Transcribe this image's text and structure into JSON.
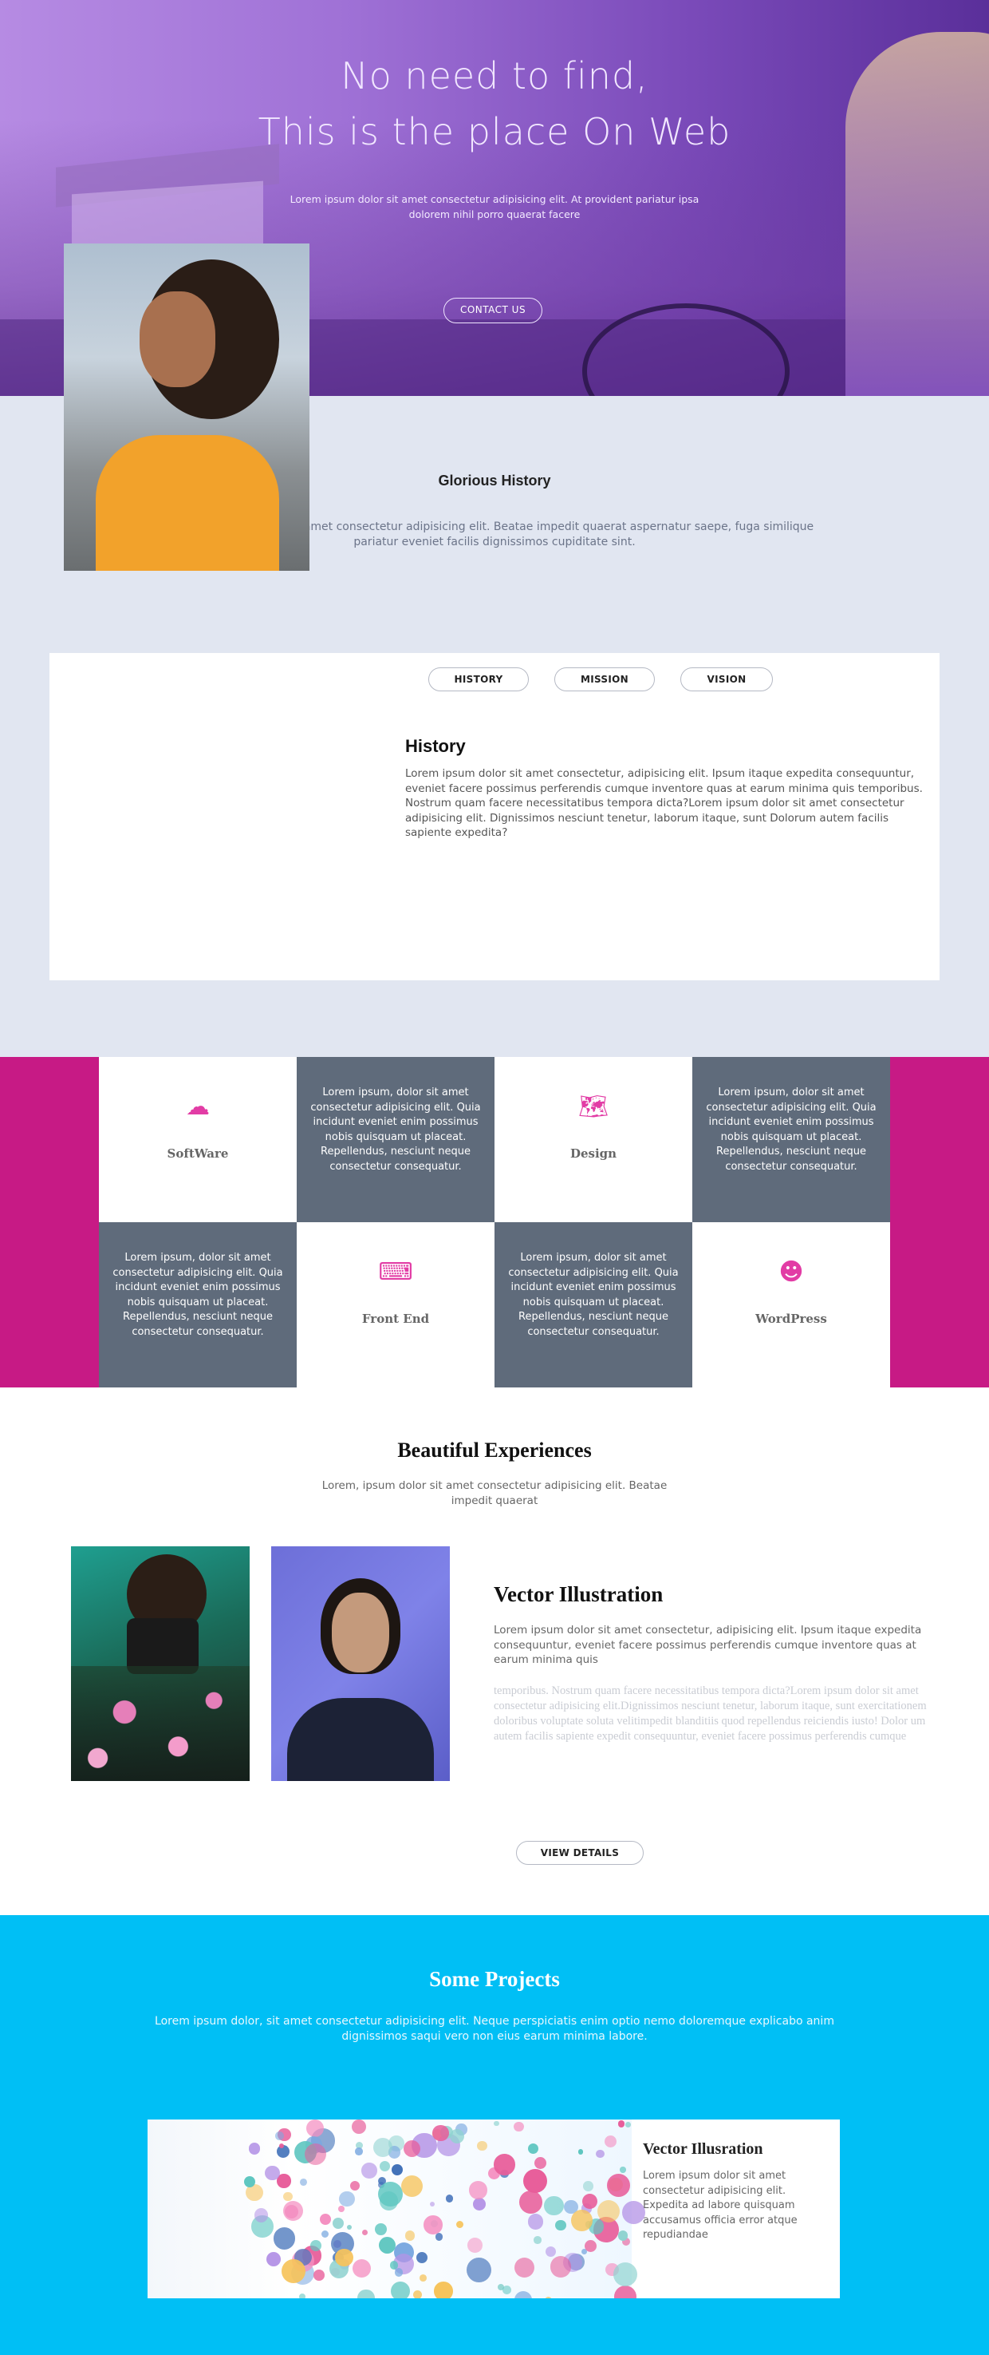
{
  "hero": {
    "title_line1": "No need to find,",
    "title_line2": "This is the place On Web",
    "lead": "Lorem ipsum dolor sit amet consectetur adipisicing elit. At provident pariatur ipsa dolorem nihil porro quaerat facere",
    "cta_label": "CONTACT US"
  },
  "history_section": {
    "title": "Glorious History",
    "description": "Lorem, ipsum dolor sit amet consectetur adipisicing elit. Beatae impedit quaerat aspernatur saepe, fuga similique pariatur eveniet facilis dignissimos cupiditate sint.",
    "tabs": [
      {
        "label": "HISTORY"
      },
      {
        "label": "MISSION"
      },
      {
        "label": "VISION"
      }
    ],
    "heading": "History",
    "body": "Lorem ipsum dolor sit amet consectetur, adipisicing elit. Ipsum itaque expedita consequuntur, eveniet facere possimus perferendis cumque inventore quas at earum minima quis temporibus. Nostrum quam facere necessitatibus tempora dicta?Lorem ipsum dolor sit amet consectetur adipisicing elit. Dignissimos nesciunt tenetur, laborum itaque, sunt Dolorum autem facilis sapiente expedita?"
  },
  "services": {
    "cells": [
      {
        "kind": "feature",
        "label": "SoftWare",
        "icon": "cloud-sun-icon",
        "glyph": "☁"
      },
      {
        "kind": "text",
        "text": "Lorem ipsum, dolor sit amet consectetur adipisicing elit. Quia incidunt eveniet enim possimus nobis quisquam ut placeat. Repellendus, nesciunt neque consectetur consequatur."
      },
      {
        "kind": "feature",
        "label": "Design",
        "icon": "world-map-icon",
        "glyph": "🗺"
      },
      {
        "kind": "text",
        "text": "Lorem ipsum, dolor sit amet consectetur adipisicing elit. Quia incidunt eveniet enim possimus nobis quisquam ut placeat. Repellendus, nesciunt neque consectetur consequatur."
      },
      {
        "kind": "text",
        "text": "Lorem ipsum, dolor sit amet consectetur adipisicing elit. Quia incidunt eveniet enim possimus nobis quisquam ut placeat. Repellendus, nesciunt neque consectetur consequatur."
      },
      {
        "kind": "feature",
        "label": "Front End",
        "icon": "laptop-code-icon",
        "glyph": "⌨"
      },
      {
        "kind": "text",
        "text": "Lorem ipsum, dolor sit amet consectetur adipisicing elit. Quia incidunt eveniet enim possimus nobis quisquam ut placeat. Repellendus, nesciunt neque consectetur consequatur."
      },
      {
        "kind": "feature",
        "label": "WordPress",
        "icon": "head-speaking-icon",
        "glyph": "☻"
      }
    ]
  },
  "experiences": {
    "title": "Beautiful Experiences",
    "description": "Lorem, ipsum dolor sit amet consectetur adipisicing elit. Beatae impedit quaerat",
    "heading": "Vector Illustration",
    "body": "Lorem ipsum dolor sit amet consectetur, adipisicing elit. Ipsum itaque expedita consequuntur, eveniet facere possimus perferendis cumque inventore quas at earum minima quis",
    "body_faded": "temporibus. Nostrum quam facere necessitatibus tempora dicta?Lorem ipsum dolor sit amet consectetur adipisicing elit.Dignissimos nesciunt tenetur, laborum itaque, sunt exercitationem doloribus voluptate soluta velitimpedit blanditiis quod repellendus reiciendis iusto! Dolor um autem facilis sapiente expedit consequuntur, eveniet facere possimus perferendis cumque",
    "button_label": "VIEW DETAILS"
  },
  "projects": {
    "title": "Some Projects",
    "description": "Lorem ipsum dolor, sit amet consectetur adipisicing elit. Neque perspiciatis enim optio nemo doloremque explicabo anim dignissimos saqui vero non eius earum minima labore.",
    "card_heading": "Vector Illusration",
    "card_body": "Lorem ipsum dolor sit amet consectetur adipisicing elit. Expedita ad labore quisquam accusamus officia error atque repudiandae"
  },
  "colors": {
    "hero_purple": "#9f71d6",
    "section_gray": "#e1e6f1",
    "magenta": "#c71a85",
    "slate": "#5f6b7b",
    "icon_pink": "#e23ca5",
    "sky_blue": "#00bff5"
  }
}
